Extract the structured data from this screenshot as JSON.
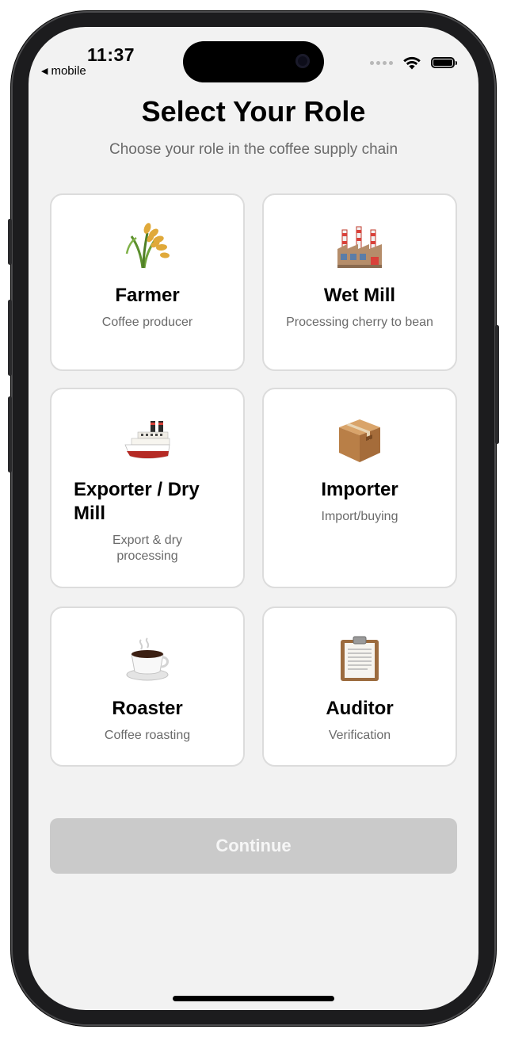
{
  "status_bar": {
    "time": "11:37",
    "back_app": "mobile",
    "back_arrow": "◀"
  },
  "header": {
    "title": "Select Your Role",
    "subtitle": "Choose your role in the coffee supply chain"
  },
  "roles": [
    {
      "name": "Farmer",
      "description": "Coffee producer",
      "icon": "rice-sheaf-icon"
    },
    {
      "name": "Wet Mill",
      "description": "Processing cherry to bean",
      "icon": "factory-icon"
    },
    {
      "name": "Exporter / Dry Mill",
      "description": "Export & dry processing",
      "icon": "ship-icon"
    },
    {
      "name": "Importer",
      "description": "Import/buying",
      "icon": "package-icon"
    },
    {
      "name": "Roaster",
      "description": "Coffee roasting",
      "icon": "hot-coffee-icon"
    },
    {
      "name": "Auditor",
      "description": "Verification",
      "icon": "clipboard-icon"
    }
  ],
  "continue_label": "Continue",
  "colors": {
    "background": "#f2f2f2",
    "card": "#ffffff",
    "card_border": "#dcdcdc",
    "button_disabled": "#cacaca",
    "muted_text": "#6a6a6a"
  }
}
